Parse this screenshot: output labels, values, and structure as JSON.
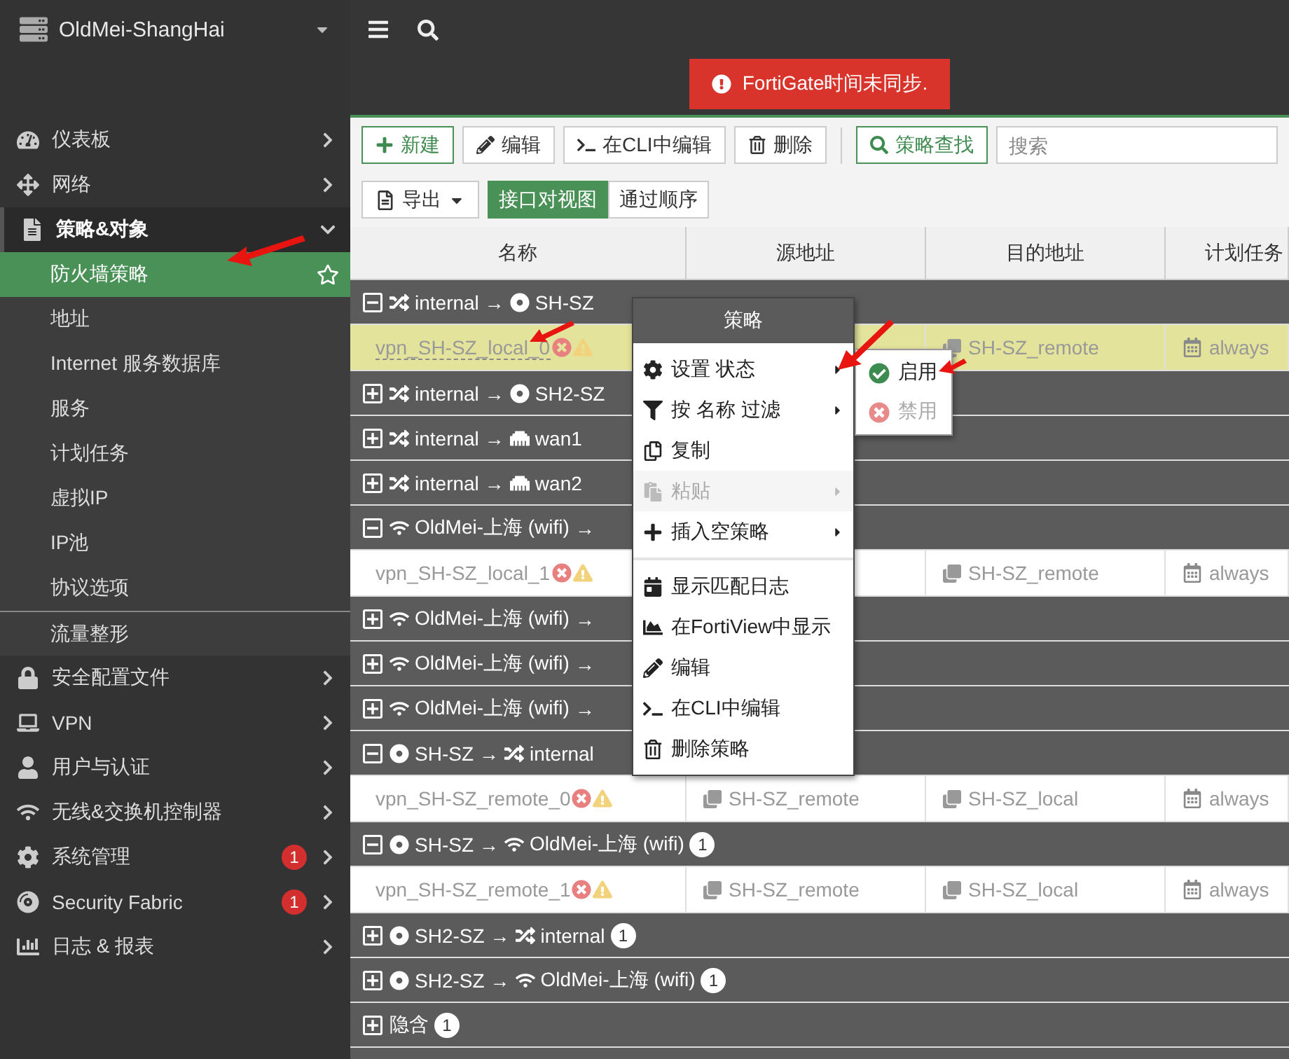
{
  "sidebar": {
    "device": "OldMei-ShangHai",
    "items": [
      {
        "label": "仪表板",
        "expanded": false
      },
      {
        "label": "网络",
        "expanded": false
      },
      {
        "label": "策略&对象",
        "expanded": true,
        "children": [
          {
            "label": "防火墙策略",
            "selected": true,
            "group_break": false
          },
          {
            "label": "地址",
            "selected": false,
            "group_break": false
          },
          {
            "label": "Internet 服务数据库",
            "selected": false,
            "group_break": false
          },
          {
            "label": "服务",
            "selected": false,
            "group_break": false
          },
          {
            "label": "计划任务",
            "selected": false,
            "group_break": false
          },
          {
            "label": "虚拟IP",
            "selected": false,
            "group_break": false
          },
          {
            "label": "IP池",
            "selected": false,
            "group_break": false
          },
          {
            "label": "协议选项",
            "selected": false,
            "group_break": false
          },
          {
            "label": "流量整形",
            "selected": false,
            "group_break": true
          }
        ]
      },
      {
        "label": "安全配置文件",
        "expanded": false
      },
      {
        "label": "VPN",
        "expanded": false
      },
      {
        "label": "用户与认证",
        "expanded": false
      },
      {
        "label": "无线&交换机控制器",
        "expanded": false
      },
      {
        "label": "系统管理",
        "expanded": false,
        "badge": "1"
      },
      {
        "label": "Security Fabric",
        "expanded": false,
        "badge": "1"
      },
      {
        "label": "日志 & 报表",
        "expanded": false
      }
    ]
  },
  "notification": {
    "text": "FortiGate时间未同步."
  },
  "toolbar": {
    "buttons": [
      {
        "label": "新建",
        "kind": "primary"
      },
      {
        "label": "编辑",
        "kind": "default"
      },
      {
        "label": "在CLI中编辑",
        "kind": "default"
      },
      {
        "label": "删除",
        "kind": "default"
      },
      {
        "label": "策略查找",
        "kind": "primary"
      }
    ],
    "search": {
      "placeholder": "搜索"
    },
    "export": {
      "label": "导出"
    },
    "views": [
      {
        "label": "接口对视图",
        "selected": true
      },
      {
        "label": "通过顺序",
        "selected": false
      }
    ]
  },
  "table": {
    "columns": [
      "名称",
      "源地址",
      "目的地址",
      "计划任务"
    ],
    "groups": [
      {
        "expanded": true,
        "source": "internal",
        "arrow": "→",
        "destination": "SH-SZ",
        "policies": [
          {
            "selected": true,
            "disabled": true,
            "warning": true,
            "name": "vpn_SH-SZ_local_0",
            "destination": "SH-SZ_remote",
            "schedule": "always"
          }
        ]
      },
      {
        "expanded": false,
        "source": "internal",
        "arrow": "→",
        "destination": "SH2-SZ"
      },
      {
        "expanded": false,
        "source": "internal",
        "arrow": "→",
        "destination": "wan1"
      },
      {
        "expanded": false,
        "source": "internal",
        "arrow": "→",
        "destination": "wan2"
      },
      {
        "expanded": true,
        "source": "OldMei-上海 (wifi)",
        "arrow": "→",
        "policies": [
          {
            "selected": false,
            "disabled": true,
            "warning": true,
            "name": "vpn_SH-SZ_local_1",
            "destination": "SH-SZ_remote",
            "schedule": "always"
          }
        ]
      },
      {
        "expanded": false,
        "source": "OldMei-上海 (wifi)",
        "arrow": "→"
      },
      {
        "expanded": false,
        "source": "OldMei-上海 (wifi)",
        "arrow": "→"
      },
      {
        "expanded": false,
        "source": "OldMei-上海 (wifi)",
        "arrow": "→"
      },
      {
        "expanded": true,
        "source": "SH-SZ",
        "arrow": "→",
        "destination": "internal",
        "policies": [
          {
            "selected": false,
            "disabled": true,
            "warning": true,
            "name": "vpn_SH-SZ_remote_0",
            "source": "SH-SZ_remote",
            "destination": "SH-SZ_local",
            "schedule": "always"
          }
        ]
      },
      {
        "expanded": true,
        "source": "SH-SZ",
        "arrow": "→",
        "destination": "OldMei-上海 (wifi)",
        "count": "1",
        "policies": [
          {
            "selected": false,
            "disabled": true,
            "warning": true,
            "name": "vpn_SH-SZ_remote_1",
            "source": "SH-SZ_remote",
            "destination": "SH-SZ_local",
            "schedule": "always"
          }
        ]
      },
      {
        "expanded": false,
        "source": "SH2-SZ",
        "arrow": "→",
        "destination": "internal",
        "count": "1"
      },
      {
        "expanded": false,
        "source": "SH2-SZ",
        "arrow": "→",
        "destination": "OldMei-上海 (wifi)",
        "count": "1"
      },
      {
        "expanded": false,
        "source": "隐含",
        "count": "1"
      }
    ]
  },
  "context_menu": {
    "title": "策略",
    "sections": [
      [
        {
          "label": "设置 状态",
          "submenu": true,
          "disabled": false
        },
        {
          "label": "按 名称 过滤",
          "submenu": true,
          "disabled": false
        },
        {
          "label": "复制",
          "submenu": false,
          "disabled": false
        },
        {
          "label": "粘贴",
          "submenu": true,
          "disabled": true
        },
        {
          "label": "插入空策略",
          "submenu": true,
          "disabled": false
        }
      ],
      [
        {
          "label": "显示匹配日志",
          "submenu": false,
          "disabled": false
        },
        {
          "label": "在FortiView中显示",
          "submenu": false,
          "disabled": false
        },
        {
          "label": "编辑",
          "submenu": false,
          "disabled": false
        },
        {
          "label": "在CLI中编辑",
          "submenu": false,
          "disabled": false
        },
        {
          "label": "删除策略",
          "submenu": false,
          "disabled": false
        }
      ]
    ],
    "submenu": [
      {
        "label": "启用",
        "disabled": false
      },
      {
        "label": "禁用",
        "disabled": true
      }
    ]
  }
}
